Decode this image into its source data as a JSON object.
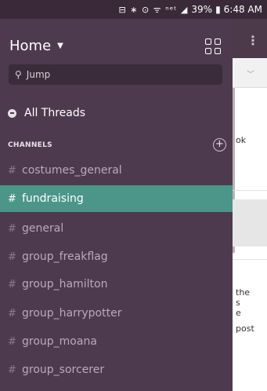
{
  "status_bar": {
    "icons": "⊟ ∗ ⊙ ᯤ ⁿᵉᵗ ◢",
    "battery": "39%",
    "time": "6:48 AM"
  },
  "drawer": {
    "workspace_name": "Home",
    "search_placeholder": "Jump",
    "all_threads_label": "All Threads",
    "channels_header": "CHANNELS",
    "channels": [
      {
        "name": "costumes_general",
        "active": false
      },
      {
        "name": "fundraising",
        "active": true
      },
      {
        "name": "general",
        "active": false
      },
      {
        "name": "group_freakflag",
        "active": false
      },
      {
        "name": "group_hamilton",
        "active": false
      },
      {
        "name": "group_harrypotter",
        "active": false
      },
      {
        "name": "group_moana",
        "active": false
      },
      {
        "name": "group_sorcerer",
        "active": false
      }
    ]
  },
  "behind_content": {
    "snippets": [
      "ok",
      "the",
      "s",
      "e",
      "post"
    ]
  },
  "colors": {
    "drawer_bg": "#4e3a4e",
    "active_channel": "#4c9689"
  }
}
